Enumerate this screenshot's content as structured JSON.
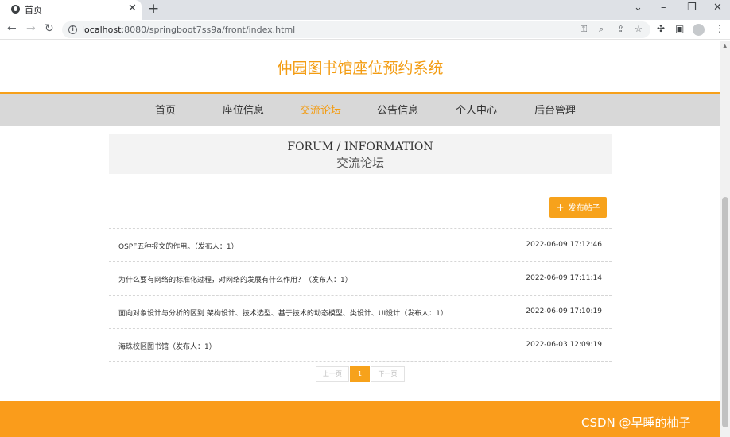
{
  "browser": {
    "tab_title": "首页",
    "tab_close": "✕",
    "new_tab": "+",
    "url_host": "localhost",
    "url_rest": ":8080/springboot7ss9a/front/index.html"
  },
  "site": {
    "title": "仲园图书馆座位预约系统"
  },
  "nav": {
    "items": [
      "首页",
      "座位信息",
      "交流论坛",
      "公告信息",
      "个人中心",
      "后台管理"
    ],
    "active": "交流论坛"
  },
  "header": {
    "en": "FORUM / INFORMATION",
    "cn": "交流论坛"
  },
  "post_button": {
    "icon": "plus-icon",
    "label": "发布帖子"
  },
  "posts": [
    {
      "title": "OSPF五种报文的作用。（发布人：1）",
      "date": "2022-06-09 17:12:46"
    },
    {
      "title": "为什么要有网络的标准化过程，对网络的发展有什么作用？（发布人：1）",
      "date": "2022-06-09 17:11:14"
    },
    {
      "title": "面向对象设计与分析的区别 架构设计、技术选型、基于技术的动态模型、类设计、UI设计（发布人：1）",
      "date": "2022-06-09 17:10:19"
    },
    {
      "title": "海珠校区图书馆（发布人：1）",
      "date": "2022-06-03 12:09:19"
    }
  ],
  "pagination": {
    "prev": "上一页",
    "current": "1",
    "next": "下一页"
  },
  "watermark": "CSDN @早睡的柚子",
  "colors": {
    "accent": "#f7a21b",
    "nav_bg": "#d8d8d8",
    "footer": "#fa9c1b"
  }
}
